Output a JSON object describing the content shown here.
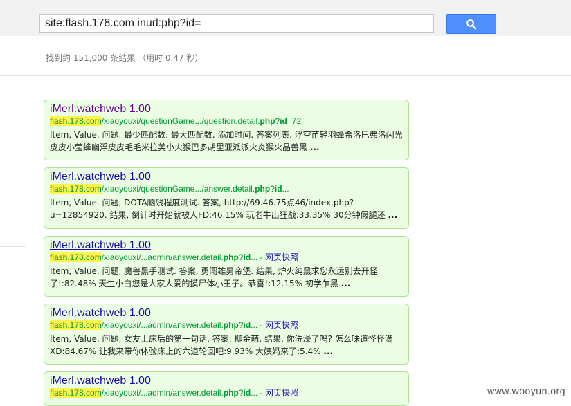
{
  "search": {
    "query": "site:flash.178.com inurl:php?id=",
    "button_icon": "search-icon",
    "stats": "找到约 151,000 条结果 （用时 0.47 秒）"
  },
  "results": [
    {
      "title": "iMerl.watchweb 1.00",
      "url_host": "flash.178.com",
      "url_path_a": "/xiaoyouxi/questionGame.../question.detail.",
      "url_bold1": "php",
      "url_mid": "?",
      "url_bold2": "id",
      "url_end": "=72",
      "cache": "",
      "snippet": "Item, Value. 问题. 最少匹配数. 最大匹配数. 添加时间. 答案列表. 浮空苗轻羽蜂希洛巴弗洛闪光皮皮小莹蜂幽浮皮皮毛毛米拉美小火猴巴多胡里亚派派火炎猴火晶兽黑",
      "more": "..."
    },
    {
      "title": "iMerl.watchweb 1.00",
      "url_host": "flash.178.com",
      "url_path_a": "/xiaoyouxi/questionGame.../answer.detail.",
      "url_bold1": "php",
      "url_mid": "?",
      "url_bold2": "id",
      "url_end": "...",
      "cache": "",
      "snippet": "Item, Value. 问题, DOTA脑残程度测试. 答案, http://69.46.75点46/index.php?u=12854920. 结果, 倒计时开始就被人FD:46.15% 玩老牛出狂战:33.35% 30分钟假腿还",
      "more": "..."
    },
    {
      "title": "iMerl.watchweb 1.00",
      "url_host": "flash.178.com",
      "url_path_a": "/xiaoyouxi/...admin/answer.detail.",
      "url_bold1": "php",
      "url_mid": "?",
      "url_bold2": "id",
      "url_end": "... - ",
      "cache": "网页快照",
      "snippet": "Item, Value. 问题, 魔兽黑手测试. 答案, 勇闯雄男帝堡. 结果, 炉火纯黑求您永远别去开怪了!:82.48% 天生小白您是人家人爱的摸尸体小王子。恭喜!:12.15% 初学乍黑",
      "more": "..."
    },
    {
      "title": "iMerl.watchweb 1.00",
      "url_host": "flash.178.com",
      "url_path_a": "/xiaoyouxi/...admin/answer.detail.",
      "url_bold1": "php",
      "url_mid": "?",
      "url_bold2": "id",
      "url_end": "... - ",
      "cache": "网页快照",
      "snippet": "Item, Value. 问题, 女友上床后的第一句话. 答案, 柳金萌. 结果, 你洗澡了吗? 怎么味道怪怪滴XD:84.67% 让我来带你体验床上的六道轮回吧:9.93% 大姨妈来了:5.4%",
      "more": "..."
    },
    {
      "title": "iMerl.watchweb 1.00",
      "url_host": "flash.178.com",
      "url_path_a": "/xiaoyouxi/...admin/answer.detail.",
      "url_bold1": "php",
      "url_mid": "?",
      "url_bold2": "id",
      "url_end": "... - ",
      "cache": "网页快照",
      "snippet": "",
      "more": ""
    }
  ],
  "watermark": "www.wooyun.org"
}
